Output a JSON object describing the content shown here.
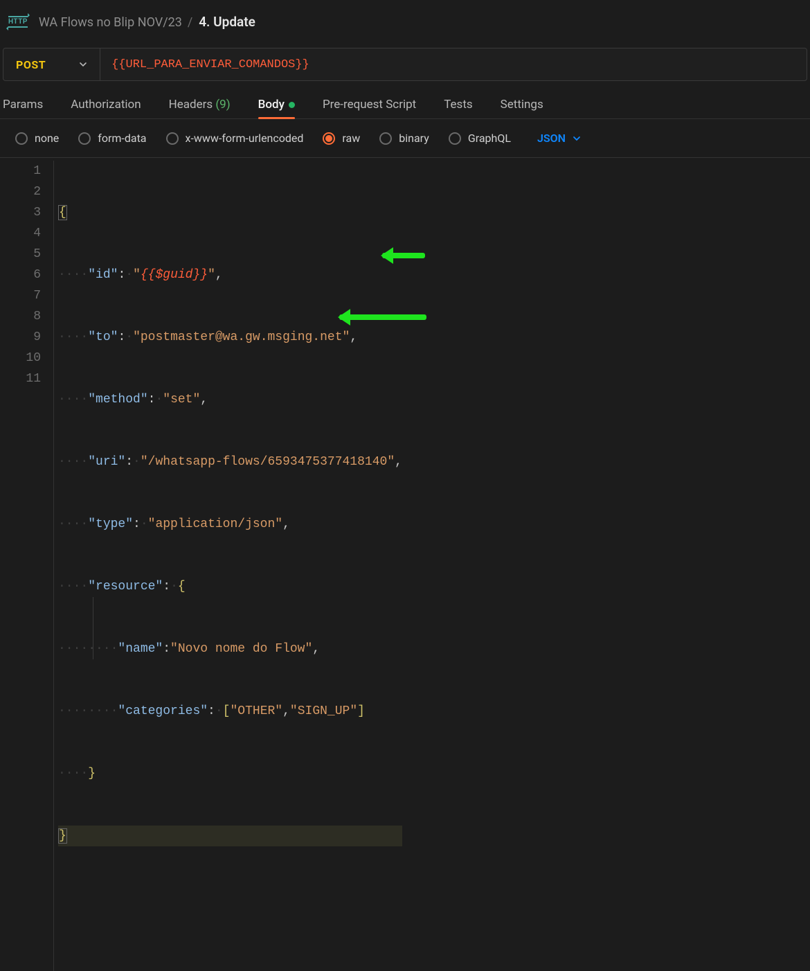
{
  "breadcrumb": {
    "collection": "WA Flows no Blip NOV/23",
    "item": "4. Update"
  },
  "request": {
    "method": "POST",
    "url_variable": "{{URL_PARA_ENVIAR_COMANDOS}}"
  },
  "tabs": {
    "params": "Params",
    "authorization": "Authorization",
    "headers_label": "Headers",
    "headers_count": "(9)",
    "body": "Body",
    "prerequest": "Pre-request Script",
    "tests": "Tests",
    "settings": "Settings"
  },
  "body_types": {
    "none": "none",
    "formdata": "form-data",
    "urlencoded": "x-www-form-urlencoded",
    "raw": "raw",
    "binary": "binary",
    "graphql": "GraphQL",
    "selected": "raw",
    "format": "JSON"
  },
  "code": {
    "id_key": "\"id\"",
    "id_var": "{{$guid}}",
    "to_key": "\"to\"",
    "to_val": "\"postmaster@wa.gw.msging.net\"",
    "method_key": "\"method\"",
    "method_val": "\"set\"",
    "uri_key": "\"uri\"",
    "uri_val": "\"/whatsapp-flows/6593475377418140\"",
    "type_key": "\"type\"",
    "type_val": "\"application/json\"",
    "resource_key": "\"resource\"",
    "name_key": "\"name\"",
    "name_val": "\"Novo nome do Flow\"",
    "categories_key": "\"categories\"",
    "cat1": "\"OTHER\"",
    "cat2": "\"SIGN_UP\""
  },
  "line_numbers": [
    "1",
    "2",
    "3",
    "4",
    "5",
    "6",
    "7",
    "8",
    "9",
    "10",
    "11"
  ]
}
